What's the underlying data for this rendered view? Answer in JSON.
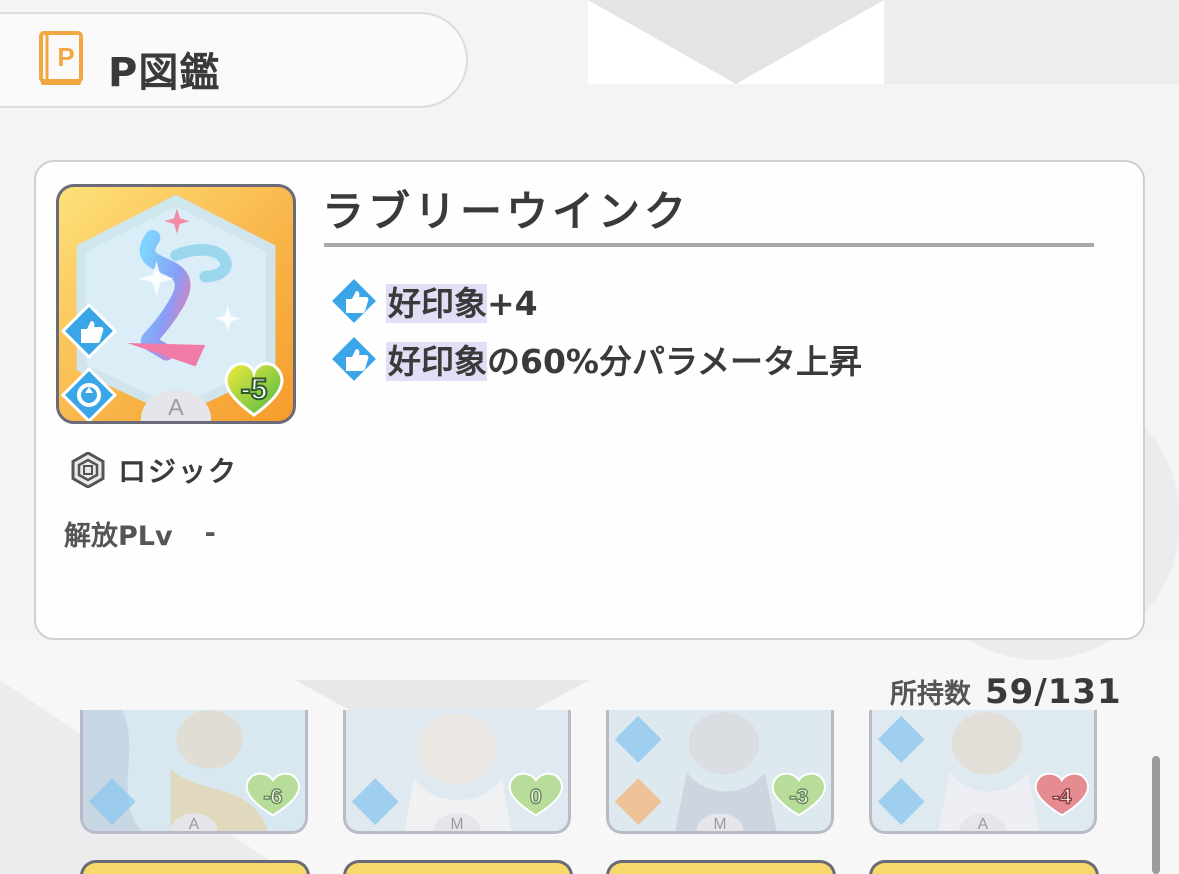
{
  "header": {
    "title": "P図鑑",
    "icon": "book-p-icon",
    "icon_letter": "P"
  },
  "detail": {
    "name": "ラブリーウインク",
    "card_cost": "-5",
    "card_rank": "A",
    "type_label": "ロジック",
    "unlock_label": "解放PLv",
    "unlock_value": "-",
    "effects": [
      {
        "icon": "thumbs-up-icon",
        "highlight": "好印象",
        "text": "+4"
      },
      {
        "icon": "thumbs-up-icon",
        "highlight": "好印象",
        "text": "の60%分パラメータ上昇"
      }
    ]
  },
  "owned": {
    "label": "所持数",
    "value": "59/131"
  },
  "grid": [
    {
      "cost": "-6",
      "rank": "A",
      "heart": "green-heart-icon"
    },
    {
      "cost": "0",
      "rank": "M",
      "heart": "green-heart-icon"
    },
    {
      "cost": "-3",
      "rank": "M",
      "heart": "green-heart-icon"
    },
    {
      "cost": "-4",
      "rank": "A",
      "heart": "red-heart-icon"
    }
  ],
  "colors": {
    "accent_orange": "#f3a742",
    "highlight": "#e2def6",
    "icon_blue": "#3aa6e8",
    "heart_green": "#6cc04a",
    "heart_red": "#e0505a"
  }
}
